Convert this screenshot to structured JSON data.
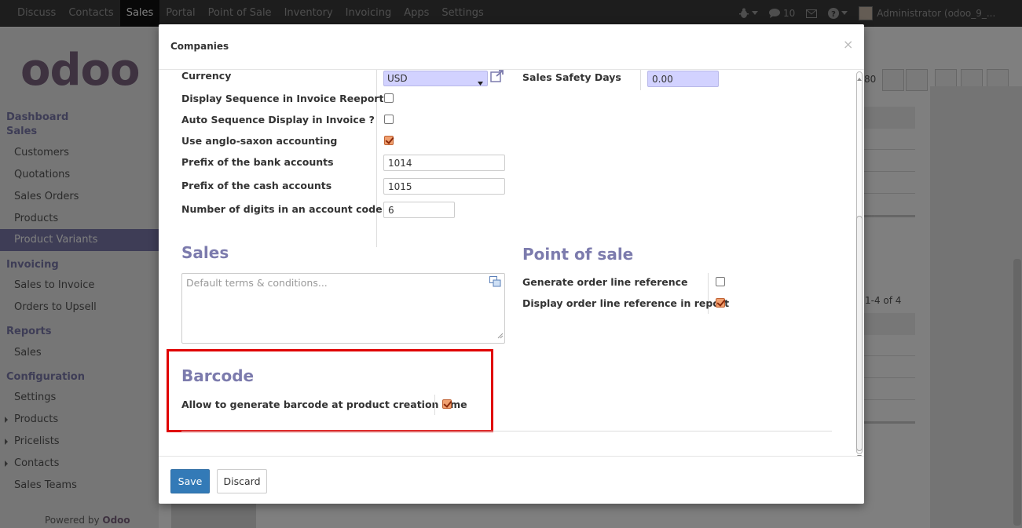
{
  "topbar": {
    "menu": [
      "Discuss",
      "Contacts",
      "Sales",
      "Portal",
      "Point of Sale",
      "Inventory",
      "Invoicing",
      "Apps",
      "Settings"
    ],
    "active_index": 2,
    "messages_count": "10",
    "user": "Administrator (odoo_9_..."
  },
  "sidebar": {
    "logo": "odoo",
    "dashboard": "Dashboard",
    "sales_head": "Sales",
    "sales_items": [
      "Customers",
      "Quotations",
      "Sales Orders",
      "Products",
      "Product Variants"
    ],
    "invoicing_head": "Invoicing",
    "invoicing_items": [
      "Sales to Invoice",
      "Orders to Upsell"
    ],
    "reports_head": "Reports",
    "reports_items": [
      "Sales"
    ],
    "config_head": "Configuration",
    "config_items": [
      "Settings",
      "Products",
      "Pricelists",
      "Contacts",
      "Sales Teams"
    ],
    "powered_prefix": "Powered by",
    "powered_brand": "Odoo"
  },
  "background": {
    "pager": "80",
    "count": "1-4 of 4"
  },
  "modal": {
    "title": "Companies",
    "close": "×",
    "fields": {
      "currency_label": "Currency",
      "currency_value": "USD",
      "sales_safety_label": "Sales Safety Days",
      "sales_safety_value": "0.00",
      "display_seq_label": "Display Sequence in Invoice Reeport ?",
      "auto_seq_label": "Auto Sequence Display in Invoice ?",
      "anglo_label": "Use anglo-saxon accounting",
      "bank_prefix_label": "Prefix of the bank accounts",
      "bank_prefix_value": "1014",
      "cash_prefix_label": "Prefix of the cash accounts",
      "cash_prefix_value": "1015",
      "digits_label": "Number of digits in an account code",
      "digits_value": "6"
    },
    "checks": {
      "display_seq": false,
      "auto_seq": false,
      "anglo": true,
      "gen_order_line": false,
      "display_order_line": true,
      "barcode": true
    },
    "sales_section": "Sales",
    "terms_placeholder": "Default terms & conditions...",
    "pos_section": "Point of sale",
    "gen_order_line_label": "Generate order line reference",
    "display_order_line_label": "Display order line reference in report",
    "barcode_section": "Barcode",
    "barcode_label": "Allow to generate barcode at product creation time",
    "save": "Save",
    "discard": "Discard"
  },
  "colors": {
    "accent": "#7c7bad",
    "highlight": "#e00000",
    "primary_button": "#337ab7"
  }
}
